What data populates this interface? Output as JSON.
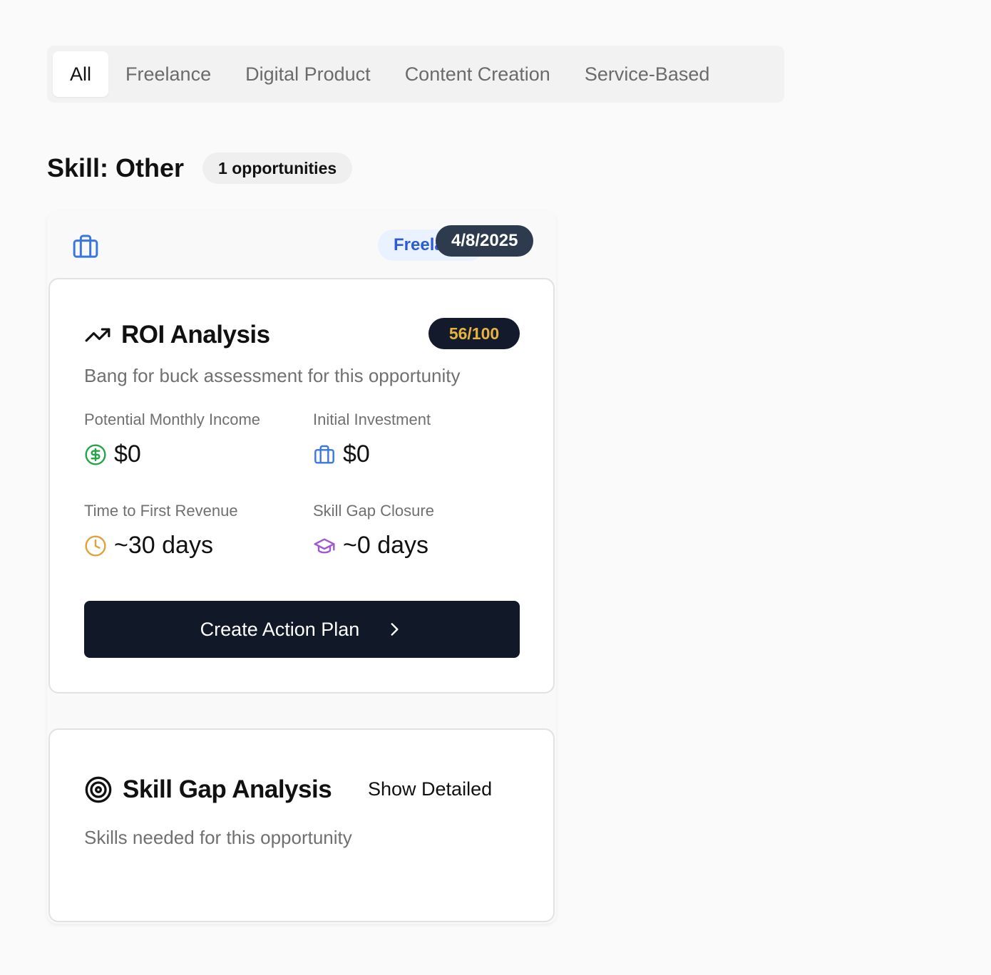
{
  "tabs": [
    {
      "label": "All",
      "active": true
    },
    {
      "label": "Freelance",
      "active": false
    },
    {
      "label": "Digital Product",
      "active": false
    },
    {
      "label": "Content Creation",
      "active": false
    },
    {
      "label": "Service-Based",
      "active": false
    }
  ],
  "section": {
    "title": "Skill: Other",
    "count_badge": "1 opportunities"
  },
  "opportunity": {
    "type_label": "Freelance",
    "date": "4/8/2025",
    "roi": {
      "title": "ROI Analysis",
      "score": "56/100",
      "description": "Bang for buck assessment for this opportunity",
      "metrics": [
        {
          "label": "Potential Monthly Income",
          "value": "$0",
          "icon": "dollar-circle-icon",
          "color": "#22a447"
        },
        {
          "label": "Initial Investment",
          "value": "$0",
          "icon": "briefcase-icon",
          "color": "#3b76e0"
        },
        {
          "label": "Time to First Revenue",
          "value": "~30 days",
          "icon": "clock-icon",
          "color": "#e3a03a"
        },
        {
          "label": "Skill Gap Closure",
          "value": "~0 days",
          "icon": "graduation-cap-icon",
          "color": "#9b59d6"
        }
      ],
      "action_button": "Create Action Plan"
    },
    "skill_gap": {
      "title": "Skill Gap Analysis",
      "toggle": "Show Detailed",
      "description": "Skills needed for this opportunity"
    }
  },
  "colors": {
    "accent_blue": "#2b5cd6",
    "dark": "#111827",
    "score_text": "#e6b33e"
  }
}
